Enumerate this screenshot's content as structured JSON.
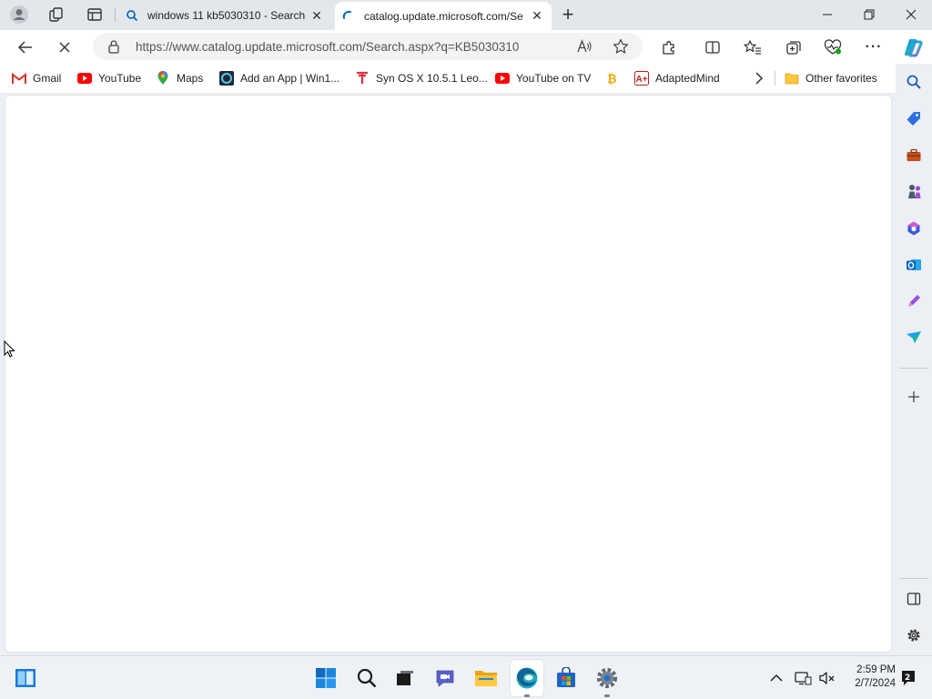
{
  "browser": {
    "tabs": [
      {
        "title": "windows 11 kb5030310 - Search",
        "active": false,
        "icon": "search-icon"
      },
      {
        "title": "catalog.update.microsoft.com/Se",
        "active": true,
        "icon": "loading-spinner-icon"
      }
    ],
    "new_tab_label": "+",
    "address_bar": {
      "url": "https://www.catalog.update.microsoft.com/Search.aspx?q=KB5030310"
    },
    "favorites": [
      {
        "label": "Gmail",
        "icon": "gmail-icon"
      },
      {
        "label": "YouTube",
        "icon": "youtube-icon"
      },
      {
        "label": "Maps",
        "icon": "maps-icon"
      },
      {
        "label": "Add an App | Win1...",
        "icon": "app-icon"
      },
      {
        "label": "Syn OS X 10.5.1 Leo...",
        "icon": "syn-icon"
      },
      {
        "label": "YouTube on TV",
        "icon": "youtube-icon"
      },
      {
        "label": "",
        "icon": "bitcoin-icon"
      },
      {
        "label": "AdaptedMind",
        "icon": "adaptedmind-icon"
      }
    ],
    "other_favorites": "Other favorites"
  },
  "taskbar": {
    "time": "2:59 PM",
    "date": "2/7/2024"
  },
  "colors": {
    "accent": "#0067c0",
    "tabstrip": "#e3e7ec",
    "youtube_red": "#ff0000"
  }
}
